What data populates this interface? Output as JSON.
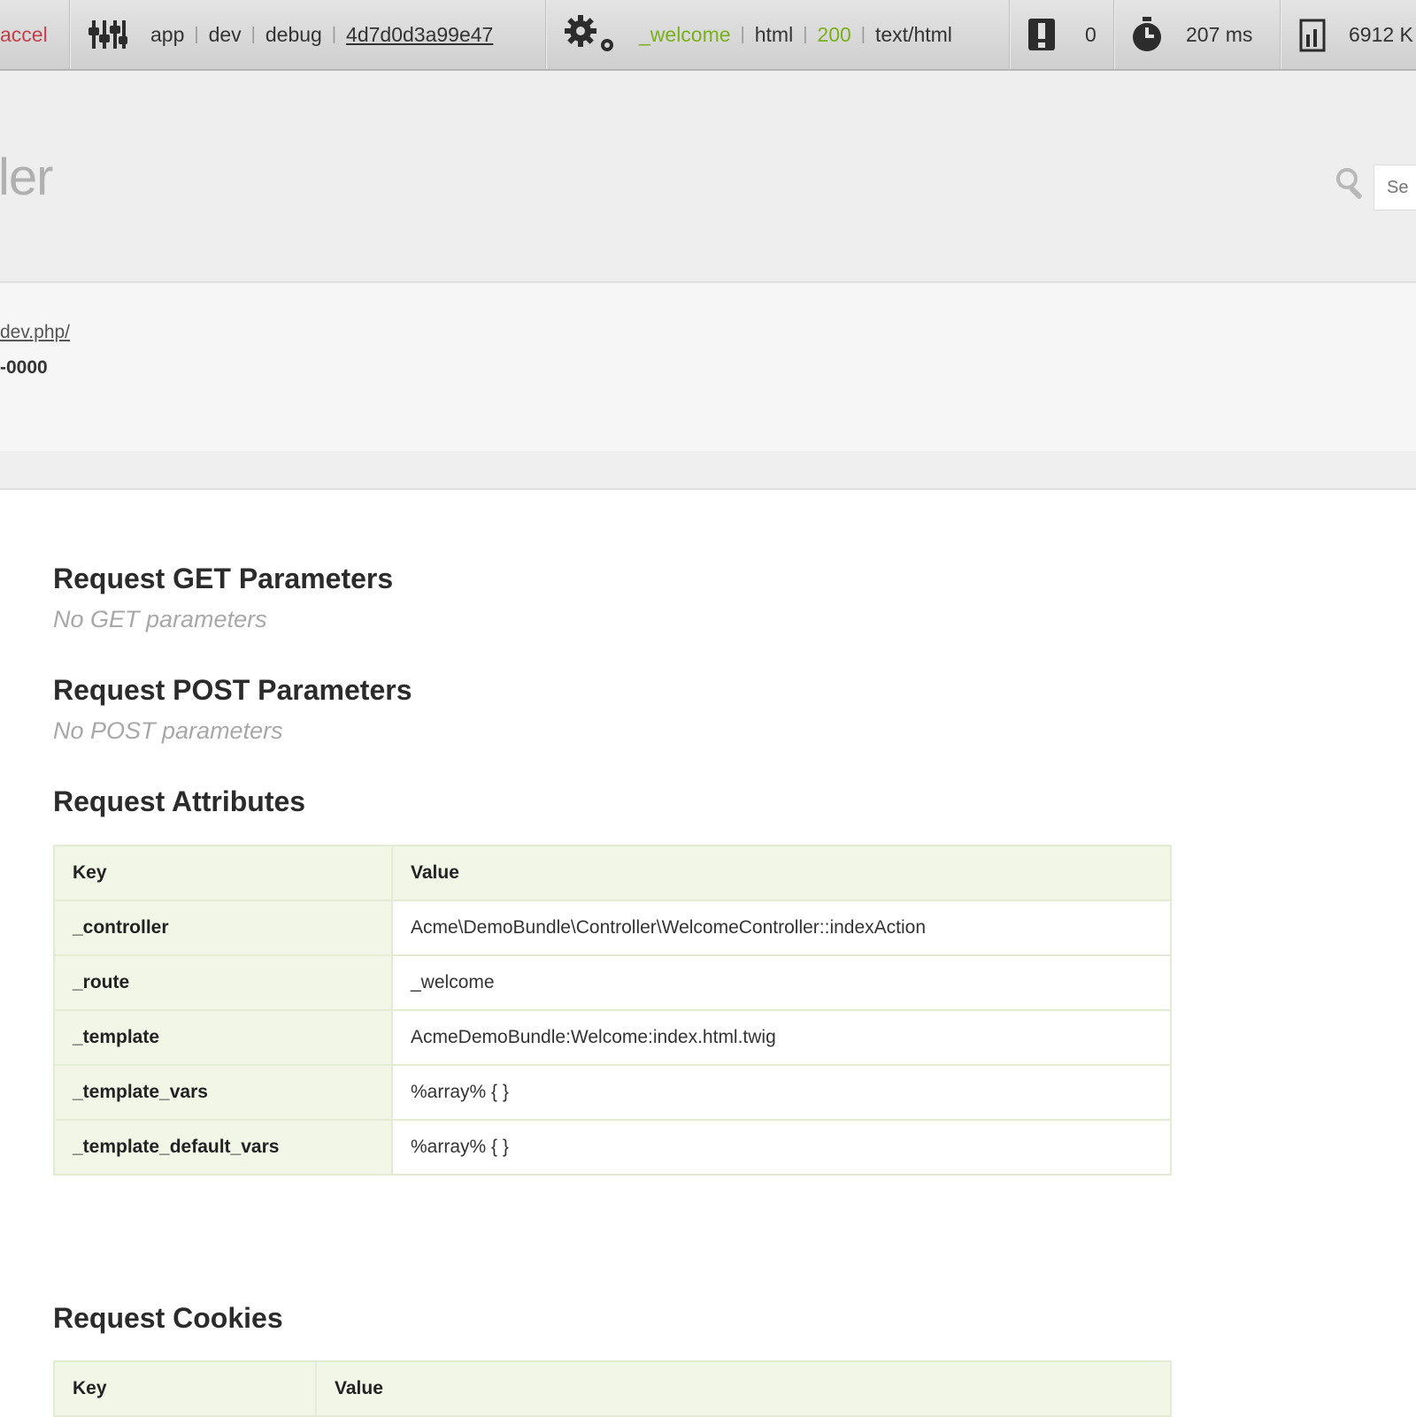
{
  "toolbar": {
    "accel_label": "accel",
    "app_env": [
      "app",
      "dev",
      "debug"
    ],
    "token": "4d7d0d3a99e47",
    "route": "_welcome",
    "format": "html",
    "status_code": "200",
    "content_type": "text/html",
    "errors_count": "0",
    "time": "207 ms",
    "memory": "6912 K",
    "colors": {
      "route": "#7ab01c",
      "status": "#7ab01c",
      "accel": "#c4404a"
    }
  },
  "header": {
    "title": "ler",
    "search_placeholder": "Se"
  },
  "summary": {
    "url": "dev.php/",
    "token_line": "-0000"
  },
  "sections": {
    "get": {
      "title": "Request GET Parameters",
      "empty": "No GET parameters"
    },
    "post": {
      "title": "Request POST Parameters",
      "empty": "No POST parameters"
    },
    "attributes": {
      "title": "Request Attributes",
      "columns": [
        "Key",
        "Value"
      ],
      "rows": [
        {
          "key": "_controller",
          "value": "Acme\\DemoBundle\\Controller\\WelcomeController::indexAction"
        },
        {
          "key": "_route",
          "value": "_welcome"
        },
        {
          "key": "_template",
          "value": "AcmeDemoBundle:Welcome:index.html.twig"
        },
        {
          "key": "_template_vars",
          "value": "%array% { }"
        },
        {
          "key": "_template_default_vars",
          "value": "%array% { }"
        }
      ]
    },
    "cookies": {
      "title": "Request Cookies",
      "columns": [
        "Key",
        "Value"
      ]
    }
  }
}
